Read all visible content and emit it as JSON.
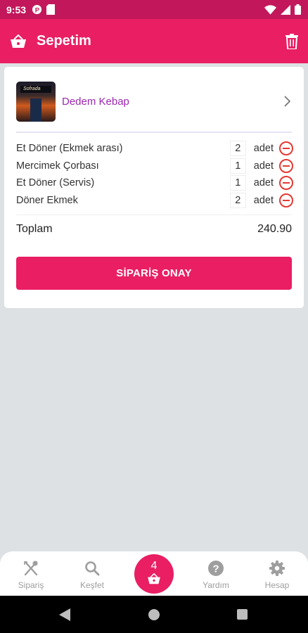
{
  "status_bar": {
    "time": "9:53"
  },
  "app_bar": {
    "title": "Sepetim",
    "icons": [
      "basket-icon",
      "trash-icon"
    ]
  },
  "restaurant": {
    "name": "Dedem Kebap",
    "sign_text": "Sofrada"
  },
  "cart": {
    "items": [
      {
        "name": "Et Döner (Ekmek arası)",
        "qty": "2",
        "unit": "adet"
      },
      {
        "name": "Mercimek Çorbası",
        "qty": "1",
        "unit": "adet"
      },
      {
        "name": "Et Döner (Servis)",
        "qty": "1",
        "unit": "adet"
      },
      {
        "name": "Döner Ekmek",
        "qty": "2",
        "unit": "adet"
      }
    ],
    "total_label": "Toplam",
    "total_value": "240.90",
    "confirm_label": "SİPARİŞ ONAY"
  },
  "bottom_nav": {
    "items": [
      {
        "label": "Sipariş",
        "icon": "fork-knife-icon"
      },
      {
        "label": "Keşfet",
        "icon": "search-icon"
      },
      {
        "label": "Yardım",
        "icon": "help-icon"
      },
      {
        "label": "Hesap",
        "icon": "gear-icon"
      }
    ],
    "cart_count": "4"
  },
  "colors": {
    "primary": "#e91e63",
    "status": "#c2185b",
    "link": "#9c27b0",
    "danger": "#e53935",
    "background": "#dde1e4"
  }
}
